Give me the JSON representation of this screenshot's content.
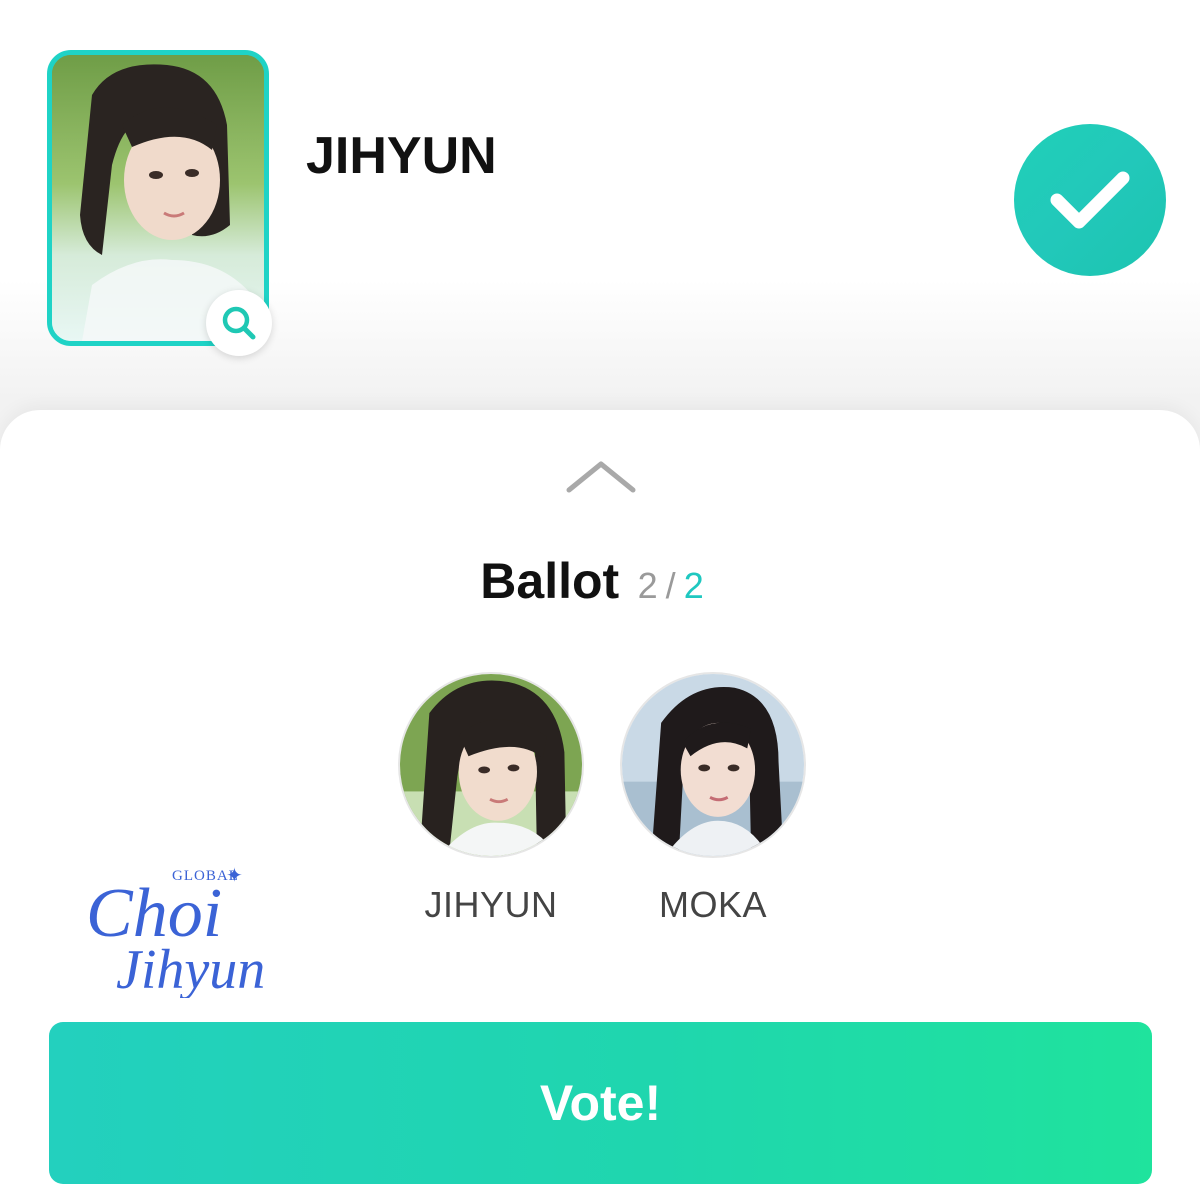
{
  "candidate": {
    "name": "JIHYUN",
    "photo_icon": "portrait-photo",
    "zoom_icon": "search-icon",
    "selected_icon": "check-icon",
    "accent_color": "#1fd3c6"
  },
  "ballot": {
    "collapse_icon": "chevron-up-icon",
    "title": "Ballot",
    "selected_count": "2",
    "separator": "/",
    "max_count": "2",
    "count_color": "#9a9a9a",
    "max_color": "#1fc8c0",
    "selected": [
      {
        "name": "JIHYUN",
        "photo_icon": "portrait-photo"
      },
      {
        "name": "MOKA",
        "photo_icon": "portrait-photo"
      }
    ]
  },
  "watermark": {
    "text_top": "GLOBAL",
    "text_line1": "Choi",
    "text_line2": "Jihyun",
    "color": "#3b63d6"
  },
  "vote_button": {
    "label": "Vote!",
    "color_start": "#23d0be",
    "color_end": "#1fe39d"
  }
}
